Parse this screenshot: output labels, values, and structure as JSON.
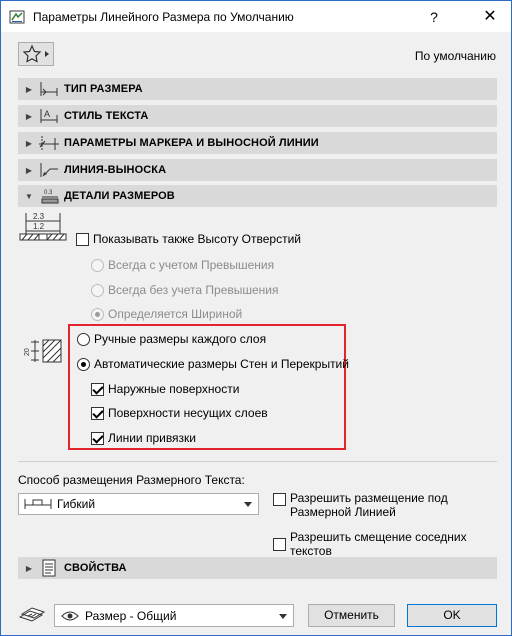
{
  "window": {
    "title": "Параметры Линейного Размера по Умолчанию",
    "help_label": "?",
    "close_label": "✕"
  },
  "toolbar": {
    "default_label": "По умолчанию"
  },
  "sections": {
    "dimension_type": "ТИП РАЗМЕРА",
    "text_style": "СТИЛЬ ТЕКСТА",
    "marker_witness": "ПАРАМЕТРЫ МАРКЕРА И ВЫНОСНОЙ ЛИНИИ",
    "leader_line": "ЛИНИЯ-ВЫНОСКА",
    "dimension_details": "ДЕТАЛИ РАЗМЕРОВ",
    "properties": "СВОЙСТВА"
  },
  "details": {
    "icon_top_label": "2.3",
    "icon_bottom_label": "1.2",
    "show_opening_height": "Показывать также Высоту Отверстий",
    "show_opening_height_checked": false,
    "opening_options": [
      {
        "label": "Всегда с учетом Превышения",
        "checked": false
      },
      {
        "label": "Всегда без учета Превышения",
        "checked": false
      },
      {
        "label": "Определяется Шириной",
        "checked": true
      }
    ],
    "layer_icon_label": "20",
    "manual_layers": "Ручные размеры каждого слоя",
    "manual_layers_checked": false,
    "auto_walls": "Автоматические размеры Стен и Перекрытий",
    "auto_walls_checked": true,
    "auto_options": [
      {
        "label": "Наружные поверхности",
        "checked": true
      },
      {
        "label": "Поверхности несущих слоев",
        "checked": true
      },
      {
        "label": "Линии привязки",
        "checked": true
      }
    ]
  },
  "placement": {
    "heading": "Способ размещения Размерного Текста:",
    "mode_value": "Гибкий",
    "allow_under_line": "Разрешить размещение под Размерной Линией",
    "allow_under_line_checked": false,
    "allow_shift": "Разрешить смещение соседних текстов",
    "allow_shift_checked": false
  },
  "footer": {
    "view_select_value": "Размер - Общий",
    "cancel_label": "Отменить",
    "ok_label": "OK"
  },
  "colors": {
    "highlight": "#e2242d",
    "section_bg": "#d9d9d9",
    "ok_border": "#0078d7"
  }
}
